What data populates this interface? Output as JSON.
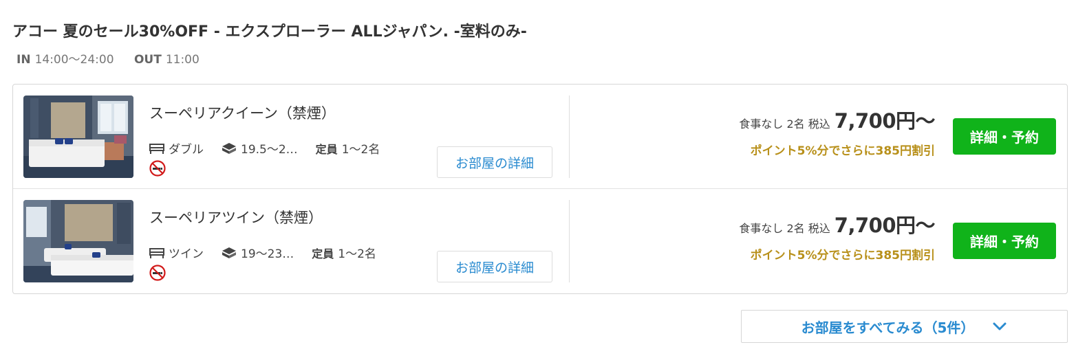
{
  "plan": {
    "title": "アコー 夏のセール30%OFF - エクスプローラー ALLジャパン. -室料のみ-",
    "checkin_label": "IN",
    "checkin_value": "14:00〜24:00",
    "checkout_label": "OUT",
    "checkout_value": "11:00"
  },
  "rooms": [
    {
      "name": "スーペリアクイーン（禁煙）",
      "bed": "ダブル",
      "area": "19.5〜2…",
      "capacity_label": "定員",
      "capacity_value": "1〜2名",
      "smoking_icon": "no-smoking-icon",
      "detail_label": "お部屋の詳細",
      "price_meta": "食事なし 2名 税込",
      "price": "7,700円〜",
      "points": "ポイント5%分でさらに385円割引",
      "book_label": "詳細・予約"
    },
    {
      "name": "スーペリアツイン（禁煙）",
      "bed": "ツイン",
      "area": "19〜23…",
      "capacity_label": "定員",
      "capacity_value": "1〜2名",
      "smoking_icon": "no-smoking-icon",
      "detail_label": "お部屋の詳細",
      "price_meta": "食事なし 2名 税込",
      "price": "7,700円〜",
      "points": "ポイント5%分でさらに385円割引",
      "book_label": "詳細・予約"
    }
  ],
  "footer": {
    "all_rooms_label": "お部屋をすべてみる（5件）"
  },
  "colors": {
    "accent_blue": "#2a8bd0",
    "book_green": "#10b31a",
    "point_gold": "#b8901a",
    "no_smoking_red": "#d11a1a"
  }
}
